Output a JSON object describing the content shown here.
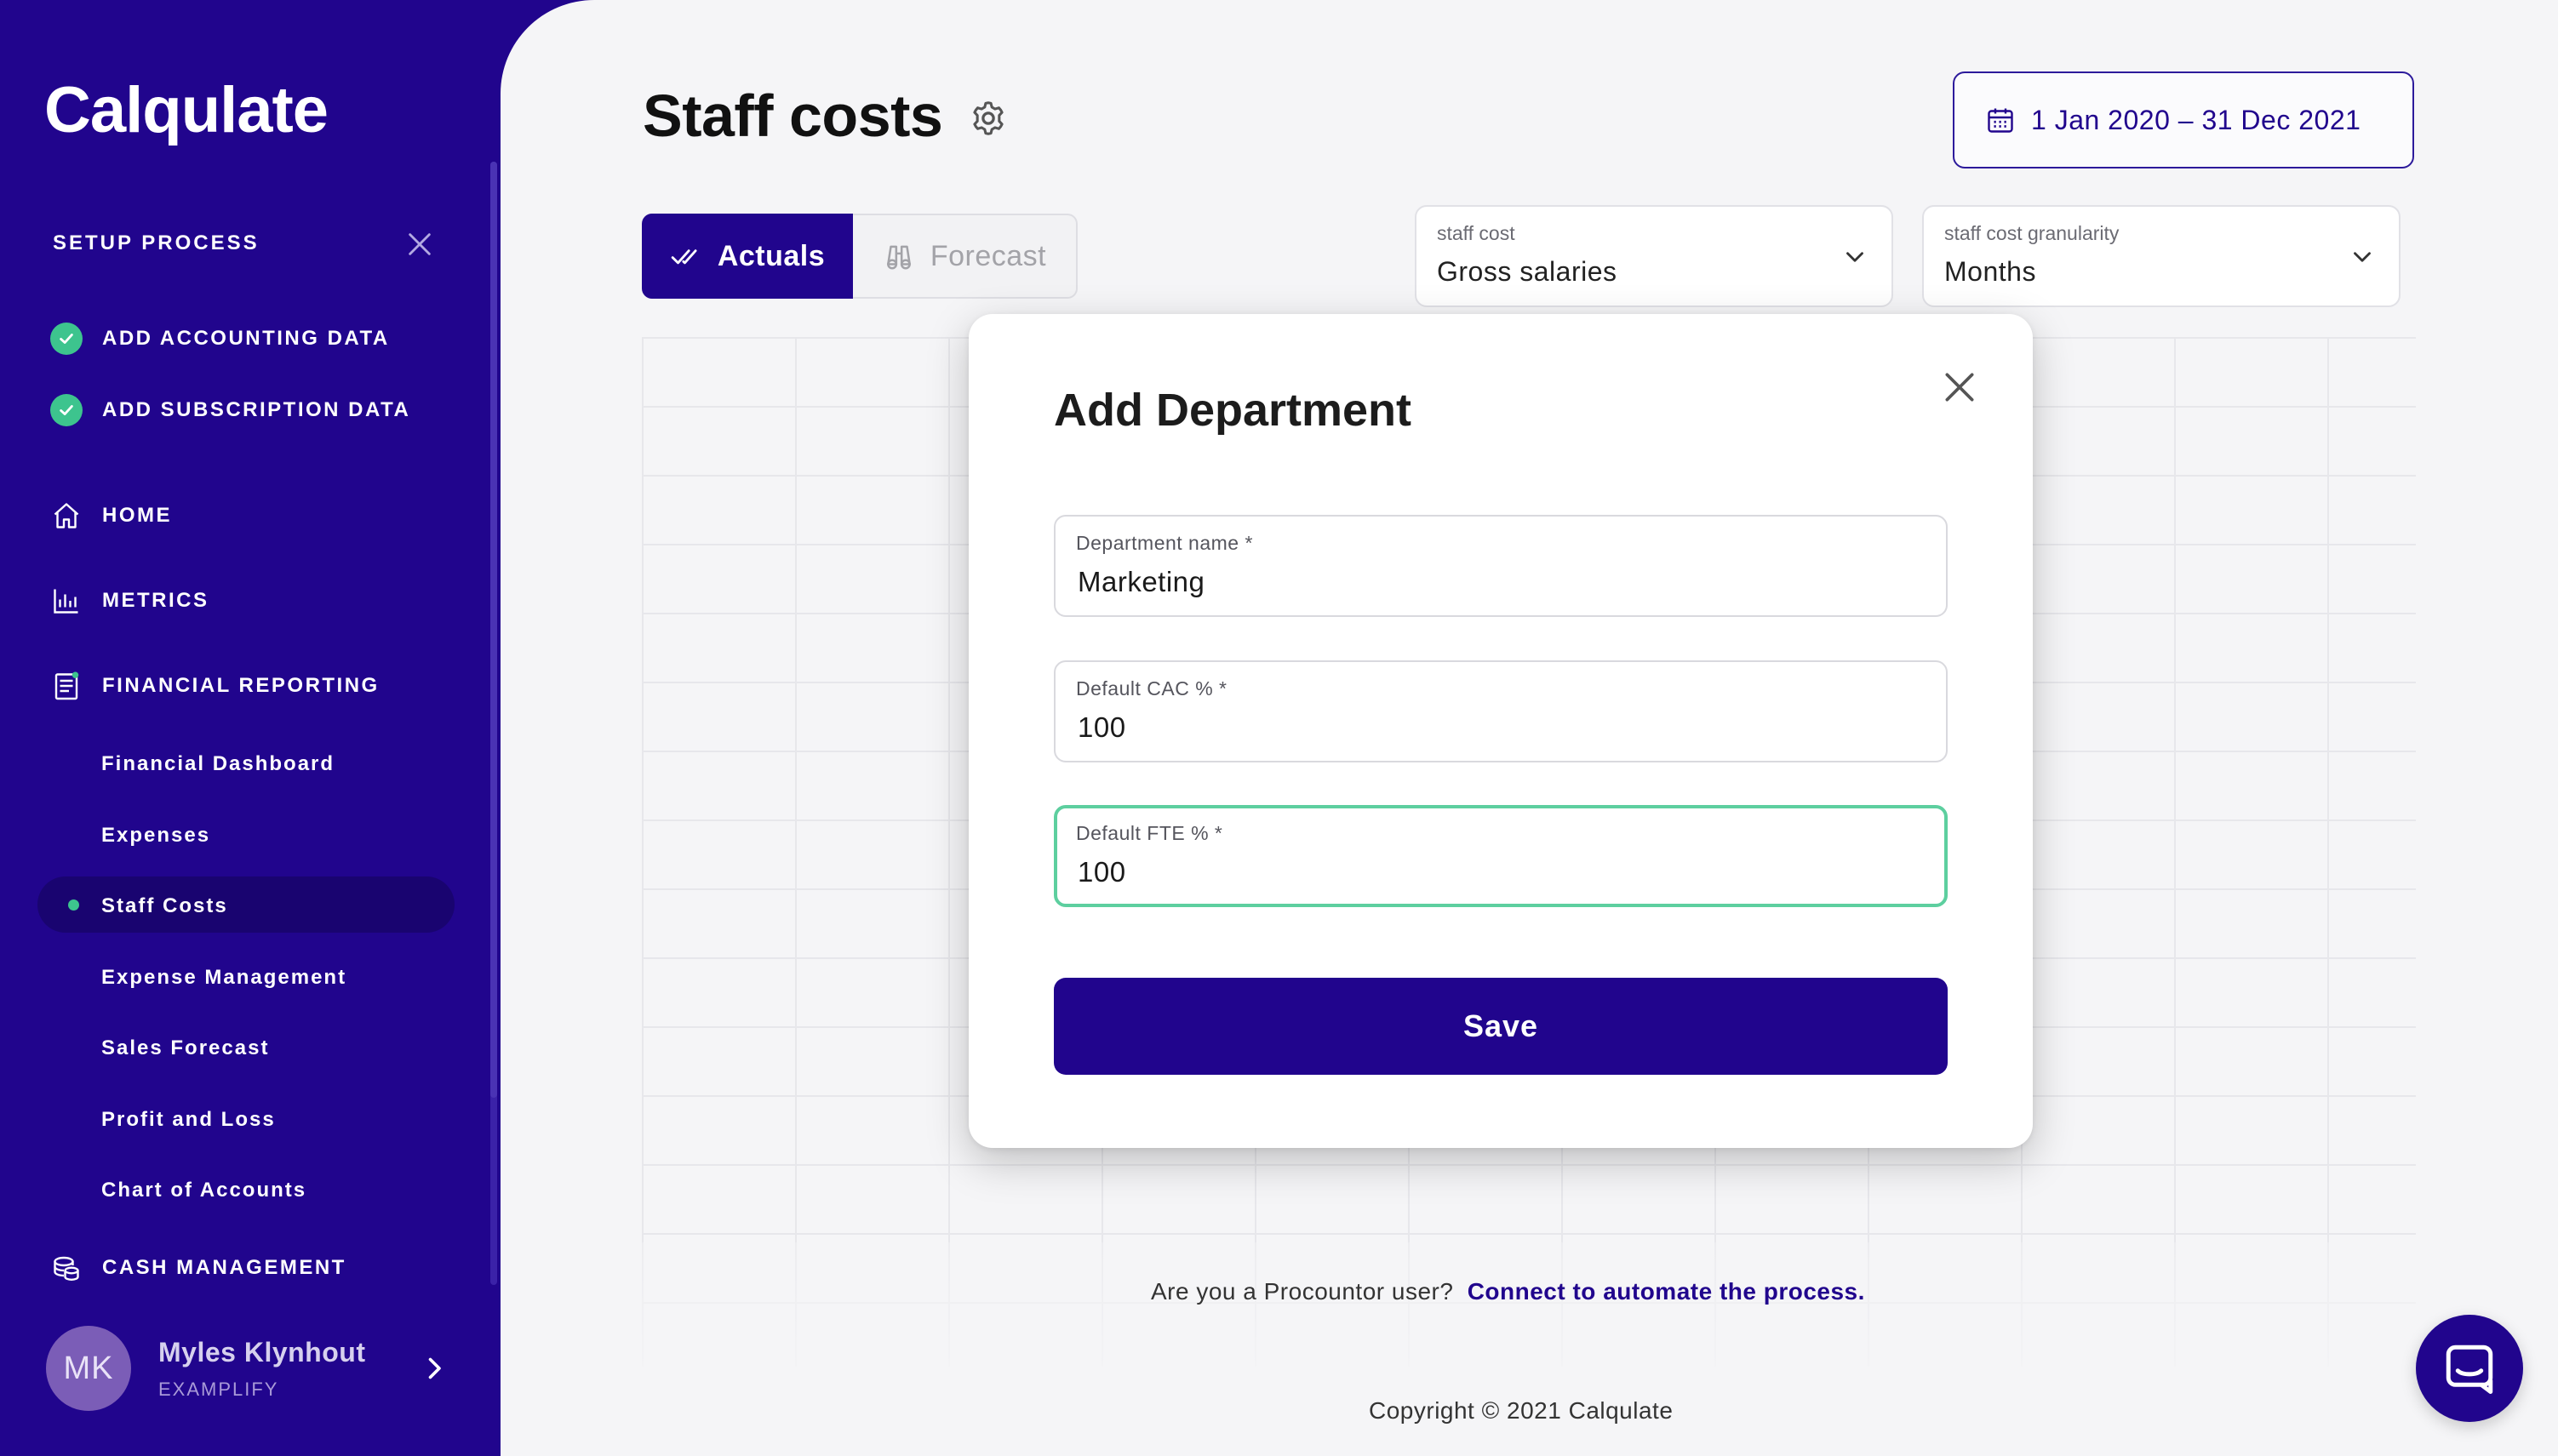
{
  "app": {
    "logo": "Calqulate"
  },
  "sidebar": {
    "setup_title": "SETUP PROCESS",
    "setup_steps": [
      {
        "label": "ADD ACCOUNTING DATA",
        "done": true
      },
      {
        "label": "ADD SUBSCRIPTION DATA",
        "done": true
      }
    ],
    "nav": [
      {
        "label": "HOME",
        "icon": "home-icon"
      },
      {
        "label": "METRICS",
        "icon": "bar-chart-icon"
      },
      {
        "label": "FINANCIAL REPORTING",
        "icon": "report-icon"
      },
      {
        "label": "CASH MANAGEMENT",
        "icon": "coins-icon"
      }
    ],
    "financial_sub": [
      "Financial Dashboard",
      "Expenses",
      "Staff Costs",
      "Expense Management",
      "Sales Forecast",
      "Profit and Loss",
      "Chart of Accounts"
    ],
    "active_item": "Staff Costs",
    "user": {
      "initials": "MK",
      "name": "Myles Klynhout",
      "org": "EXAMPLIFY"
    }
  },
  "header": {
    "title": "Staff costs",
    "date_range": "1 Jan 2020 – 31 Dec 2021"
  },
  "toggle": {
    "actuals": "Actuals",
    "forecast": "Forecast",
    "selected": "Actuals"
  },
  "filters": {
    "staff_cost": {
      "label": "staff cost",
      "value": "Gross salaries"
    },
    "granularity": {
      "label": "staff cost granularity",
      "value": "Months"
    }
  },
  "footer": {
    "question": "Are you a Procountor user?",
    "link": "Connect to automate the process.",
    "copyright": "Copyright © 2021 Calqulate"
  },
  "modal": {
    "title": "Add Department",
    "fields": [
      {
        "label": "Department name *",
        "value": "Marketing"
      },
      {
        "label": "Default CAC % *",
        "value": "100"
      },
      {
        "label": "Default FTE % *",
        "value": "100"
      }
    ],
    "save_label": "Save"
  },
  "colors": {
    "brand": "#21058d",
    "success": "#3dc48e",
    "focus": "#5dcf9f"
  }
}
